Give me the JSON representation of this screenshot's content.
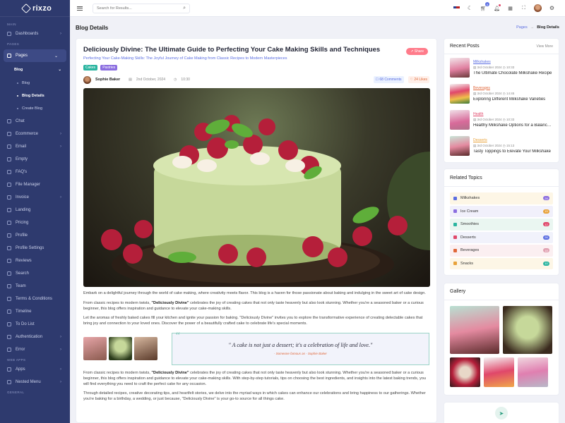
{
  "app": {
    "name": "rixzo"
  },
  "sidebar": {
    "sections": {
      "main": "MAIN",
      "pages": "PAGES",
      "web_apps": "WEB APPS",
      "general": "GENERAL"
    },
    "dashboards": "Dashboards",
    "pages": "Pages",
    "blog": "Blog",
    "blog_children": [
      "Blog",
      "Blog Details",
      "Create Blog"
    ],
    "items": [
      "Chat",
      "Ecommerce",
      "Email",
      "Empty",
      "FAQ's",
      "File Manager",
      "Invoice",
      "Landing",
      "Pricing",
      "Profile",
      "Profile Settings",
      "Reviews",
      "Search",
      "Team",
      "Terms & Conditions",
      "Timeline",
      "To Do List"
    ],
    "authentication": "Authentication",
    "error": "Error",
    "apps": "Apps",
    "nested_menu": "Nested Menu"
  },
  "topbar": {
    "search_placeholder": "Search for Results...",
    "cart_badge": "5"
  },
  "page": {
    "title": "Blog Details",
    "breadcrumb": [
      "Pages",
      "Blog Details"
    ]
  },
  "post": {
    "title": "Deliciously Divine: The Ultimate Guide to Perfecting Your Cake Making Skills and Techniques",
    "subtitle": "Perfecting Your Cake-Making Skills: The Joyful Journey of Cake Making from Classic Recipes to Modern Masterpieces",
    "share": "Share",
    "tags": [
      {
        "label": "Cakes",
        "color": "#2bb5a0"
      },
      {
        "label": "Pastries",
        "color": "#8b6ee0"
      }
    ],
    "author": "Sophie Baker",
    "date": "2nd October, 2024",
    "time": "10:30",
    "comments": "68 Comments",
    "likes": "24 Likes",
    "para1": "Embark on a delightful journey through the world of cake making, where creativity meets flavor. This blog is a haven for those passionate about baking and indulging in the sweet art of cake design.",
    "para2_pre": "From classic recipes to modern twists, ",
    "para2_bold": "\"Deliciously Divine\"",
    "para2_post": " celebrates the joy of creating cakes that not only taste heavenly but also look stunning. Whether you're a seasoned baker or a curious beginner, this blog offers inspiration and guidance to elevate your cake-making skills.",
    "para3": "Let the aromas of freshly baked cakes fill your kitchen and ignite your passion for baking. \"Deliciously Divine\" invites you to explore the transformative experience of creating delectable cakes that bring joy and connection to your loved ones. Discover the power of a beautifully crafted cake to celebrate life's special moments.",
    "quote": "\" A cake is not just a dessert; it's a celebration of life and love.\"",
    "quote_author": "- Someone famous as - Sophie Baker",
    "para4_pre": "From classic recipes to modern twists, ",
    "para4_bold": "\"Deliciously Divine\"",
    "para4_post": " celebrates the joy of creating cakes that not only taste heavenly but also look stunning. Whether you're a seasoned baker or a curious beginner, this blog offers inspiration and guidance to elevate your cake-making skills. With step-by-step tutorials, tips on choosing the best ingredients, and insights into the latest baking trends, you will find everything you need to craft the perfect cake for any occasion.",
    "para5": "Through detailed recipes, creative decorating tips, and heartfelt stories, we delve into the myriad ways in which cakes can enhance our celebrations and bring happiness to our gatherings. Whether you're baking for a birthday, a wedding, or just because, \"Deliciously Divine\" is your go-to source for all things cake."
  },
  "recent_posts": {
    "title": "Recent Posts",
    "view_more": "View More",
    "items": [
      {
        "category": "Milkshakes",
        "cat_color": "#5b6ee1",
        "date": "3rd October 2024",
        "time": "10:33",
        "title": "The Ultimate Chocolate Milkshake Recipe"
      },
      {
        "category": "Beverages",
        "cat_color": "#e0673a",
        "date": "3rd October 2024",
        "time": "14:45",
        "title": "Exploring Different Milkshake Varieties"
      },
      {
        "category": "Health",
        "cat_color": "#e0476a",
        "date": "3rd October 2024",
        "time": "10:33",
        "title": "Healthy Milkshake Options for a Balanced Diet"
      },
      {
        "category": "Desserts",
        "cat_color": "#e8a23a",
        "date": "3rd October 2024",
        "time": "15:13",
        "title": "Tasty Toppings to Elevate Your Milkshake"
      }
    ]
  },
  "related_topics": {
    "title": "Related Topics",
    "items": [
      {
        "label": "Milkshakes",
        "count": "28",
        "bg": "#fdf6e6",
        "badge": "#8b6ee0",
        "icon": "#5b6ee1"
      },
      {
        "label": "Ice Cream",
        "count": "15",
        "bg": "#f1f0fb",
        "badge": "#e8a23a",
        "icon": "#8b6ee0"
      },
      {
        "label": "Smoothies",
        "count": "12",
        "bg": "#eaf6f1",
        "badge": "#e0476a",
        "icon": "#2bb5a0"
      },
      {
        "label": "Desserts",
        "count": "26",
        "bg": "#f1f2fb",
        "badge": "#5b6ee1",
        "icon": "#e0476a"
      },
      {
        "label": "Beverages",
        "count": "18",
        "bg": "#fbeff1",
        "badge": "#e0a0b0",
        "icon": "#e0673a"
      },
      {
        "label": "Snacks",
        "count": "10",
        "bg": "#fdf6e6",
        "badge": "#2bb5a0",
        "icon": "#e8a23a"
      }
    ]
  },
  "gallery": {
    "title": "Gallery"
  }
}
